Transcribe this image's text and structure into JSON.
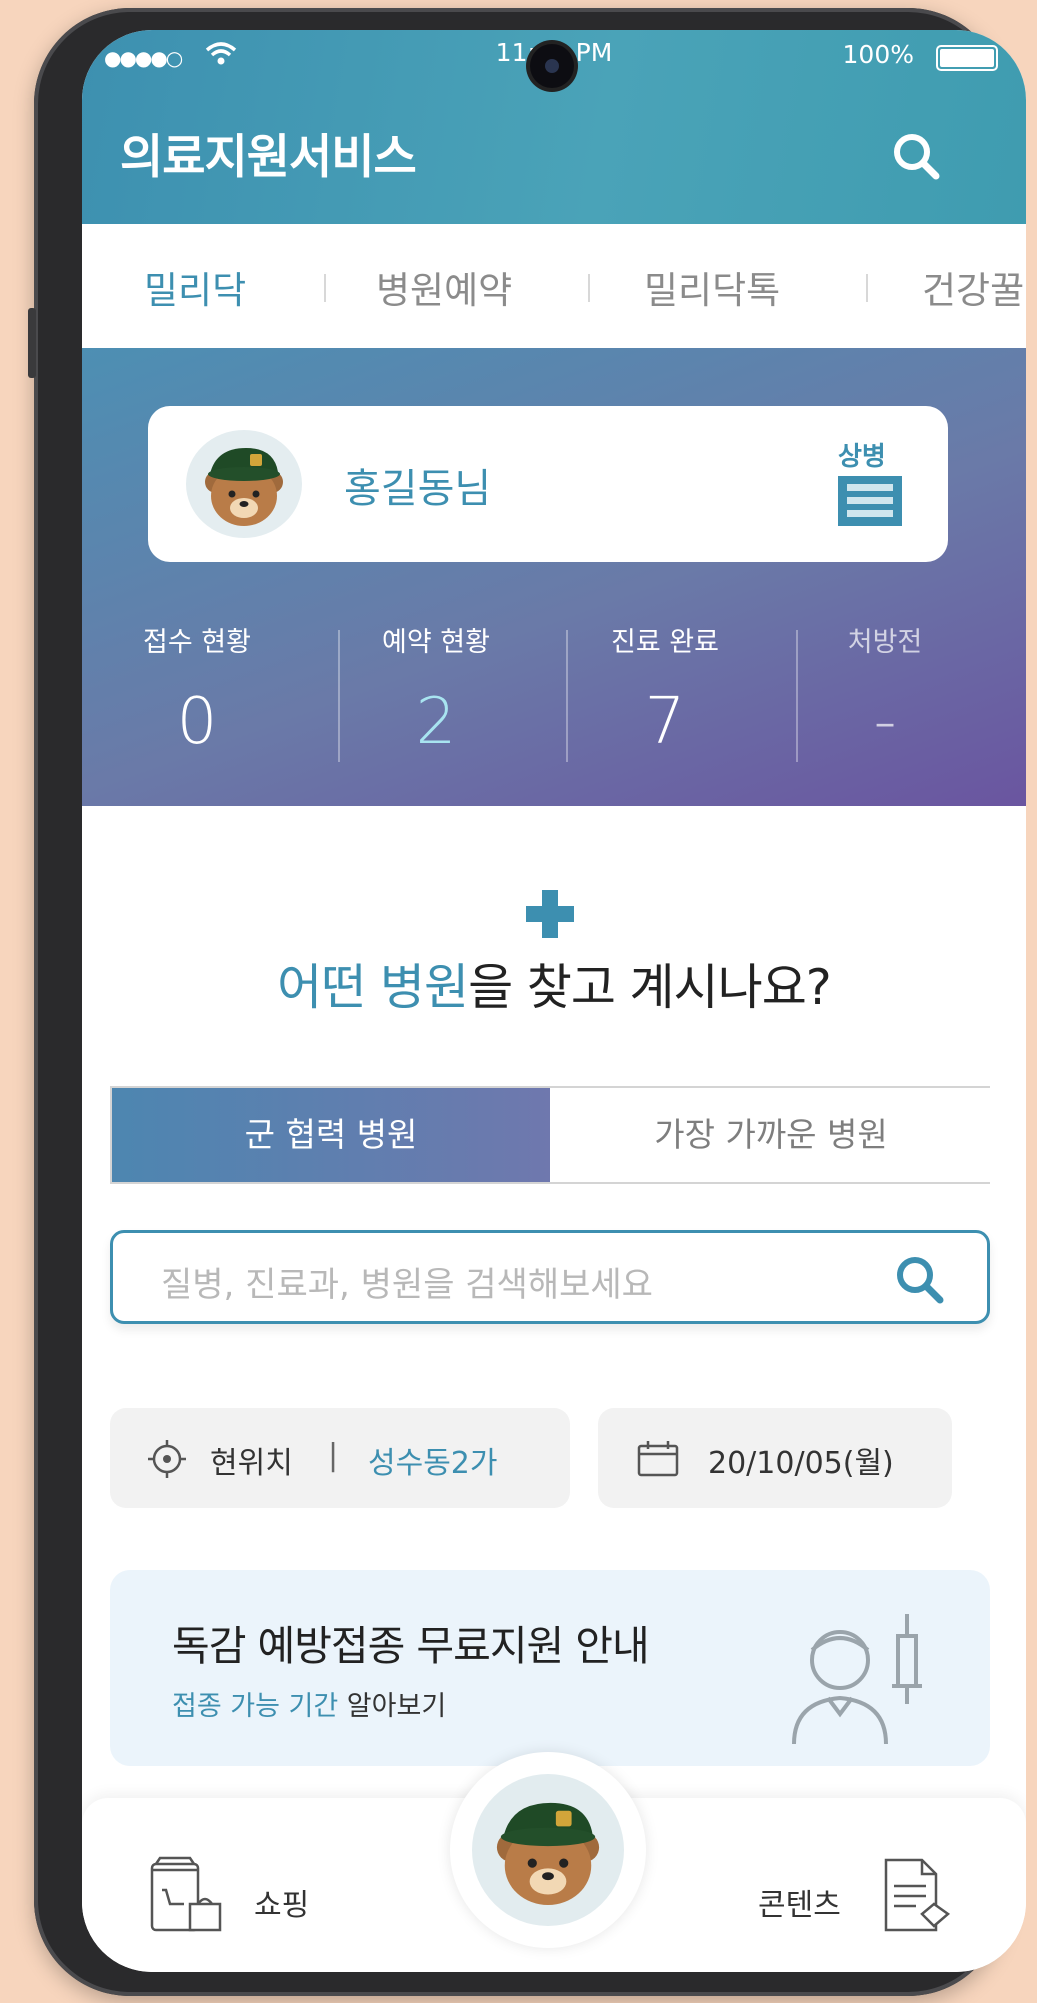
{
  "status_bar": {
    "signal": "●●●●○",
    "time": "11:14 PM",
    "battery": "100%"
  },
  "header": {
    "title": "의료지원서비스"
  },
  "tabs": [
    {
      "label": "밀리닥"
    },
    {
      "label": "병원예약"
    },
    {
      "label": "밀리닥톡"
    },
    {
      "label": "건강꿀"
    }
  ],
  "profile": {
    "name": "홍길동님",
    "rank": "상병"
  },
  "stats": [
    {
      "label": "접수 현황",
      "value": "0"
    },
    {
      "label": "예약 현황",
      "value": "2"
    },
    {
      "label": "진료 완료",
      "value": "7"
    },
    {
      "label": "처방전",
      "value": "-"
    }
  ],
  "main": {
    "question_accent": "어떤 병원",
    "question_rest": "을 찾고 계시나요?"
  },
  "segment": {
    "active": "군 협력 병원",
    "inactive": "가장 가까운 병원"
  },
  "search": {
    "placeholder": "질병, 진료과, 병원을 검색해보세요"
  },
  "location": {
    "label": "현위치",
    "divider": "|",
    "value": "성수동2가"
  },
  "date": {
    "value": "20/10/05(월)"
  },
  "banner": {
    "title": "독감 예방접종 무료지원 안내",
    "sub_accent": "접종 가능 기간",
    "sub_rest": " 알아보기"
  },
  "bottom_nav": {
    "left_label": "쇼핑",
    "right_label": "콘텐츠"
  },
  "colors": {
    "primary": "#3d8fb0",
    "hero_end": "#6a55a0",
    "highlight": "#a8e4f0"
  }
}
